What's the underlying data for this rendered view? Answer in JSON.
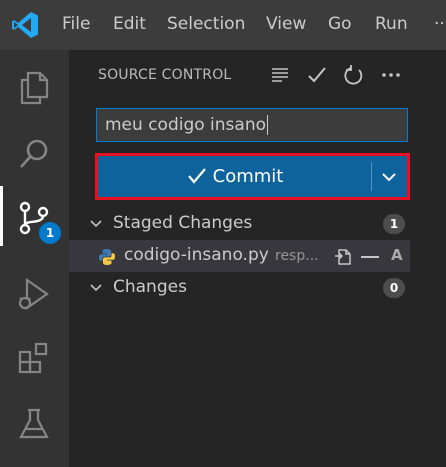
{
  "menu": [
    "File",
    "Edit",
    "Selection",
    "View",
    "Go",
    "Run",
    "···"
  ],
  "activity": {
    "scm_badge": "1"
  },
  "scm": {
    "title": "SOURCE CONTROL",
    "input_value": "meu codigo insano",
    "commit_label": "Commit",
    "staged": {
      "label": "Staged Changes",
      "count": "1",
      "files": [
        {
          "name": "codigo-insano.py",
          "description": "resp...",
          "status": "A"
        }
      ]
    },
    "changes": {
      "label": "Changes",
      "count": "0"
    }
  },
  "colors": {
    "accent": "#007acc",
    "commit_button": "#0e639c",
    "highlight_border": "#e81123"
  }
}
